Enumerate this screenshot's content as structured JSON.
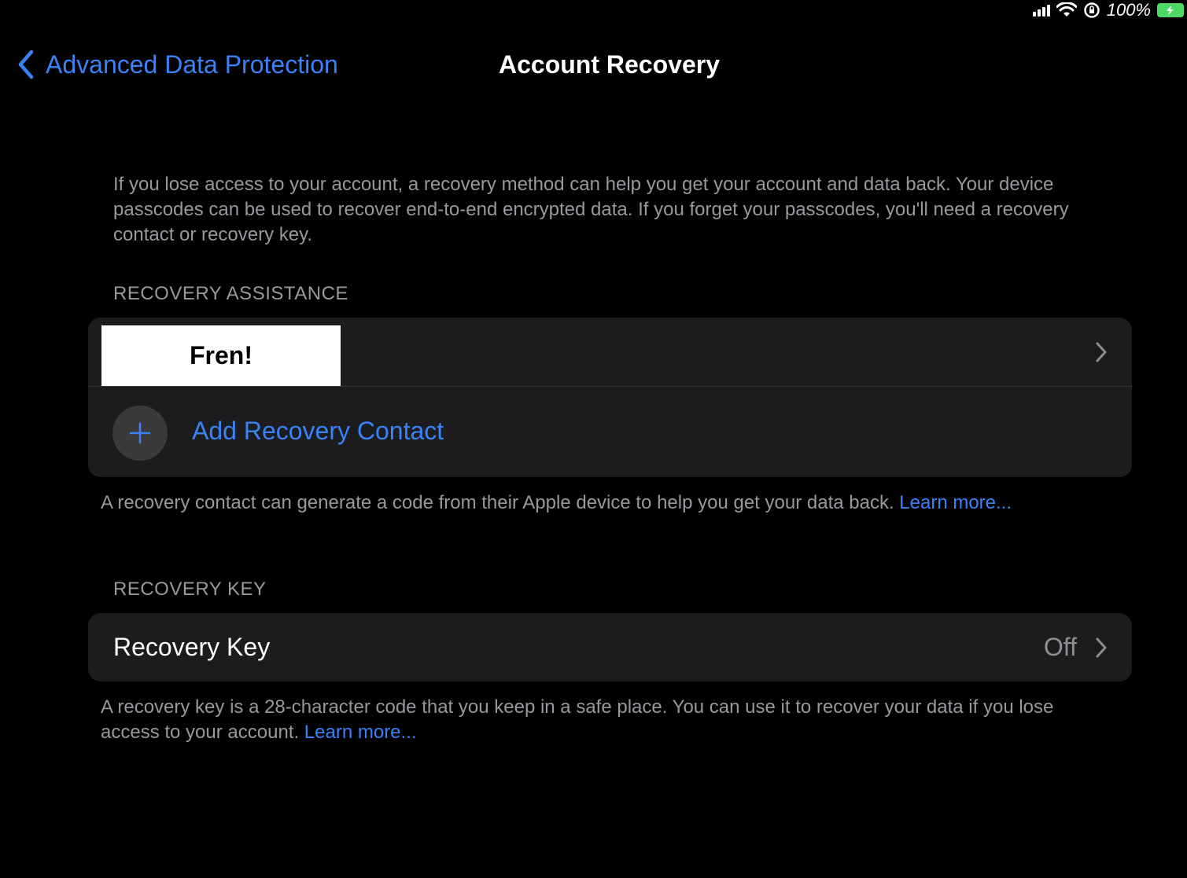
{
  "status_bar": {
    "battery_percent": "100%",
    "battery_level": 1.0,
    "accent_color": "#4cd964"
  },
  "nav": {
    "back_label": "Advanced Data Protection",
    "title": "Account Recovery",
    "back_icon": "chevron-left-icon"
  },
  "intro": {
    "text": "If you lose access to your account, a recovery method can help you get your account and data back. Your device passcodes can be used to recover end-to-end encrypted data. If you forget your passcodes, you'll need a recovery contact or recovery key."
  },
  "recovery_assistance": {
    "header": "RECOVERY ASSISTANCE",
    "contact_name": "Fren!",
    "add_label": "Add Recovery Contact",
    "footer_text": "A recovery contact can generate a code from their Apple device to help you get your data back. ",
    "footer_link": "Learn more..."
  },
  "recovery_key": {
    "header": "RECOVERY KEY",
    "label": "Recovery Key",
    "value": "Off",
    "footer_text": "A recovery key is a 28-character code that you keep in a safe place. You can use it to recover your data if you lose access to your account. ",
    "footer_link": "Learn more..."
  },
  "colors": {
    "background": "#000000",
    "card": "#1c1c1e",
    "accent": "#3a82f7",
    "secondary_text": "#98989f"
  }
}
